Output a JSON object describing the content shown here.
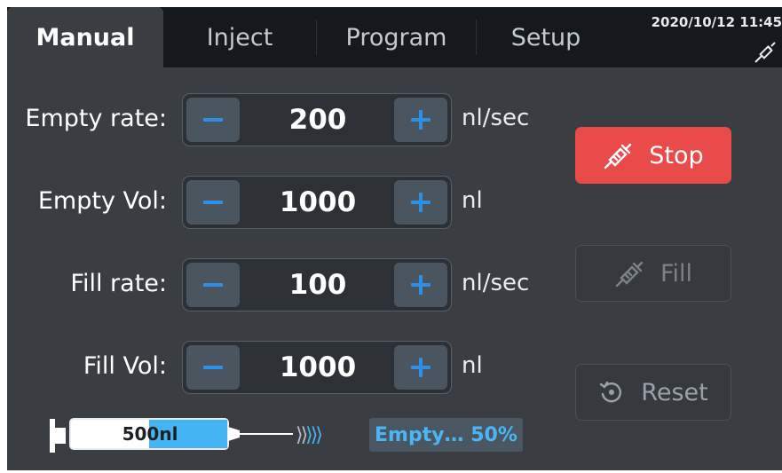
{
  "header": {
    "tabs": [
      {
        "label": "Manual",
        "active": true
      },
      {
        "label": "Inject",
        "active": false
      },
      {
        "label": "Program",
        "active": false
      },
      {
        "label": "Setup",
        "active": false
      }
    ],
    "datetime": "2020/10/12 11:45",
    "status_icon": "syringe-icon"
  },
  "params": [
    {
      "label": "Empty rate:",
      "value": "200",
      "unit": "nl/sec"
    },
    {
      "label": "Empty Vol:",
      "value": "1000",
      "unit": "nl"
    },
    {
      "label": "Fill rate:",
      "value": "100",
      "unit": "nl/sec"
    },
    {
      "label": "Fill Vol:",
      "value": "1000",
      "unit": "nl"
    }
  ],
  "actions": {
    "stop_label": "Stop",
    "fill_label": "Fill",
    "reset_label": "Reset"
  },
  "syringe": {
    "volume": "500nl",
    "fill_fraction": 0.5,
    "status": "Empty… 50%"
  },
  "colors": {
    "background": "#3a3e43",
    "tabbar": "#15181c",
    "accent": "#2d8fe6",
    "stop": "#e84b49",
    "fluid": "#44b4f3"
  }
}
